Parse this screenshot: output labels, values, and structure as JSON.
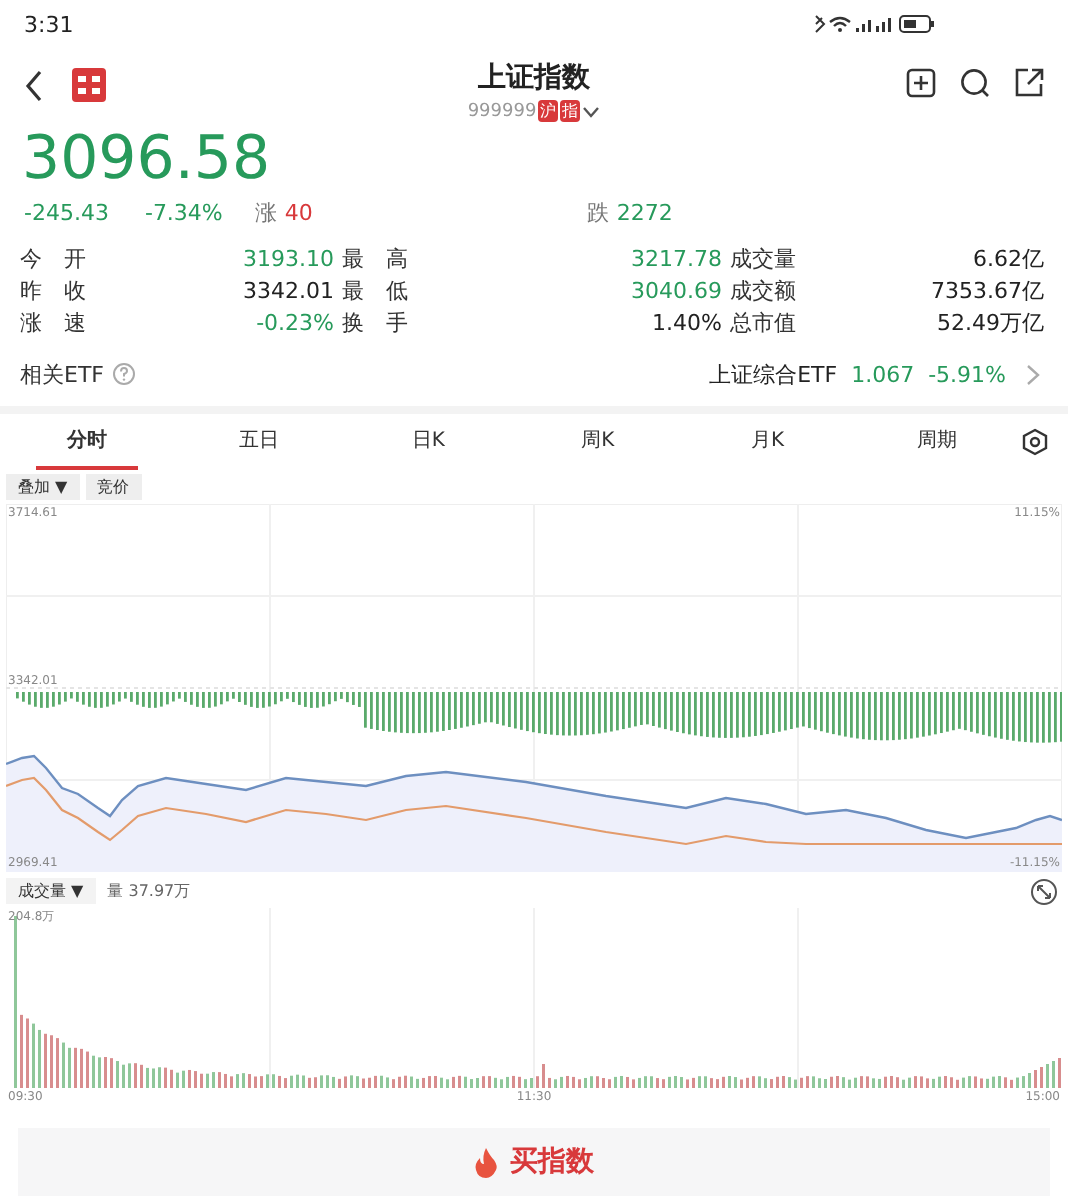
{
  "status_bar": {
    "time": "3:31"
  },
  "header": {
    "title": "上证指数",
    "code": "999999",
    "badges": [
      "沪",
      "指"
    ]
  },
  "quote": {
    "price": "3096.58",
    "change": "-245.43",
    "change_pct": "-7.34%",
    "up_label": "涨",
    "up_count": "40",
    "down_label": "跌",
    "down_count": "2272"
  },
  "stats": [
    {
      "label": "今　开",
      "value": "3193.10",
      "color": "#279a5b"
    },
    {
      "label": "最　高",
      "value": "3217.78",
      "color": "#279a5b"
    },
    {
      "label": "成交量",
      "value": "6.62亿",
      "color": "#222222"
    },
    {
      "label": "昨　收",
      "value": "3342.01",
      "color": "#222222"
    },
    {
      "label": "最　低",
      "value": "3040.69",
      "color": "#279a5b"
    },
    {
      "label": "成交额",
      "value": "7353.67亿",
      "color": "#222222"
    },
    {
      "label": "涨　速",
      "value": "-0.23%",
      "color": "#279a5b"
    },
    {
      "label": "换　手",
      "value": "1.40%",
      "color": "#222222"
    },
    {
      "label": "总市值",
      "value": "52.49万亿",
      "color": "#222222"
    }
  ],
  "etf": {
    "label": "相关ETF",
    "name": "上证综合ETF",
    "price": "1.067",
    "change": "-5.91%"
  },
  "tabs": [
    {
      "label": "分时",
      "selected": true
    },
    {
      "label": "五日",
      "selected": false
    },
    {
      "label": "日K",
      "selected": false
    },
    {
      "label": "周K",
      "selected": false
    },
    {
      "label": "月K",
      "selected": false
    },
    {
      "label": "周期",
      "selected": false
    }
  ],
  "chart": {
    "overlay_button": "叠加 ▼",
    "auction_button": "竞价",
    "top_price": "3714.61",
    "top_pct": "11.15%",
    "mid_price": "3342.01",
    "bottom_price": "2969.41",
    "bottom_pct": "-11.15%"
  },
  "volume": {
    "label": "成交量 ▼",
    "reading": "量 37.97万",
    "max": "204.8万",
    "times": [
      "09:30",
      "11:30",
      "15:00"
    ]
  },
  "buy_button": "买指数"
}
